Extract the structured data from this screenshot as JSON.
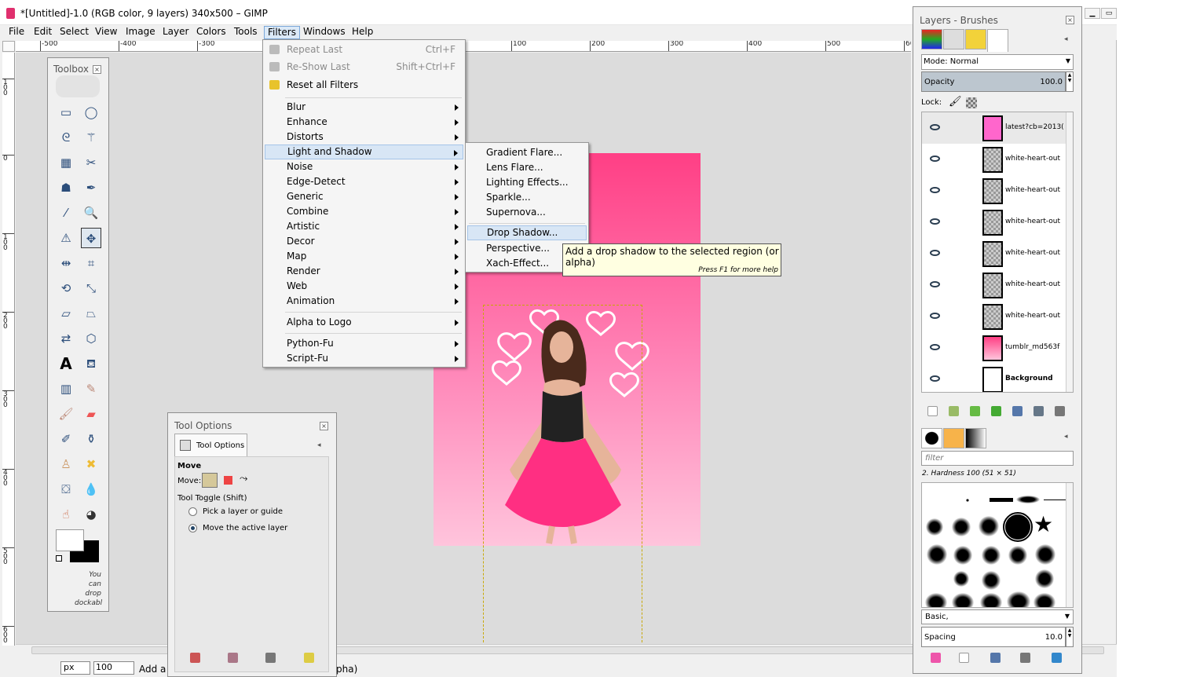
{
  "window": {
    "title": "*[Untitled]-1.0 (RGB color, 9 layers) 340x500 – GIMP"
  },
  "menubar": [
    "File",
    "Edit",
    "Select",
    "View",
    "Image",
    "Layer",
    "Colors",
    "Tools",
    "Filters",
    "Windows",
    "Help"
  ],
  "ruler": {
    "h_labels": [
      "-500",
      "-400",
      "-300",
      "100",
      "200",
      "300",
      "400",
      "500",
      "60"
    ],
    "v_labels": [
      "100",
      "0",
      "100",
      "200",
      "300",
      "400",
      "500",
      "600"
    ]
  },
  "filters_menu": {
    "top": [
      {
        "label": "Repeat Last",
        "shortcut": "Ctrl+F",
        "enabled": false
      },
      {
        "label": "Re-Show Last",
        "shortcut": "Shift+Ctrl+F",
        "enabled": false
      },
      {
        "label": "Reset all Filters",
        "shortcut": "",
        "enabled": true
      }
    ],
    "groups": [
      "Blur",
      "Enhance",
      "Distorts",
      "Light and Shadow",
      "Noise",
      "Edge-Detect",
      "Generic",
      "Combine",
      "Artistic",
      "Decor",
      "Map",
      "Render",
      "Web",
      "Animation"
    ],
    "logo": [
      "Alpha to Logo"
    ],
    "scripts": [
      "Python-Fu",
      "Script-Fu"
    ]
  },
  "light_shadow_menu": {
    "group1": [
      "Gradient Flare...",
      "Lens Flare...",
      "Lighting Effects...",
      "Sparkle...",
      "Supernova..."
    ],
    "group2": [
      "Drop Shadow...",
      "Perspective...",
      "Xach-Effect..."
    ]
  },
  "tooltip": {
    "text": "Add a drop shadow to the selected region (or alpha)",
    "help": "Press F1 for more help"
  },
  "toolbox": {
    "title": "Toolbox",
    "drop_hint": "You can drop dockabl"
  },
  "tool_options": {
    "title": "Tool Options",
    "tab": "Tool Options",
    "tool_name": "Move",
    "move_label": "Move:",
    "toggle_label": "Tool Toggle  (Shift)",
    "options": [
      {
        "label": "Pick a layer or guide",
        "selected": false
      },
      {
        "label": "Move the active layer",
        "selected": true
      }
    ]
  },
  "layers_dock": {
    "title": "Layers - Brushes",
    "mode": "Mode: Normal",
    "opacity_label": "Opacity",
    "opacity_value": "100.0",
    "lock_label": "Lock:",
    "layers": [
      "latest?cb=2013(",
      "white-heart-out",
      "white-heart-out",
      "white-heart-out",
      "white-heart-out",
      "white-heart-out",
      "white-heart-out",
      "tumblr_md563f",
      "Background"
    ]
  },
  "brushes": {
    "filter_placeholder": "filter",
    "selected": "2. Hardness 100 (51 × 51)",
    "preset": "Basic,",
    "spacing_label": "Spacing",
    "spacing_value": "10.0"
  },
  "statusbar": {
    "unit": "px",
    "zoom": "100",
    "message": "Add a",
    "tail": "pha)"
  },
  "colors": {
    "accent": "#d8e6f5",
    "canvas_pink": "#ff4d8f"
  }
}
